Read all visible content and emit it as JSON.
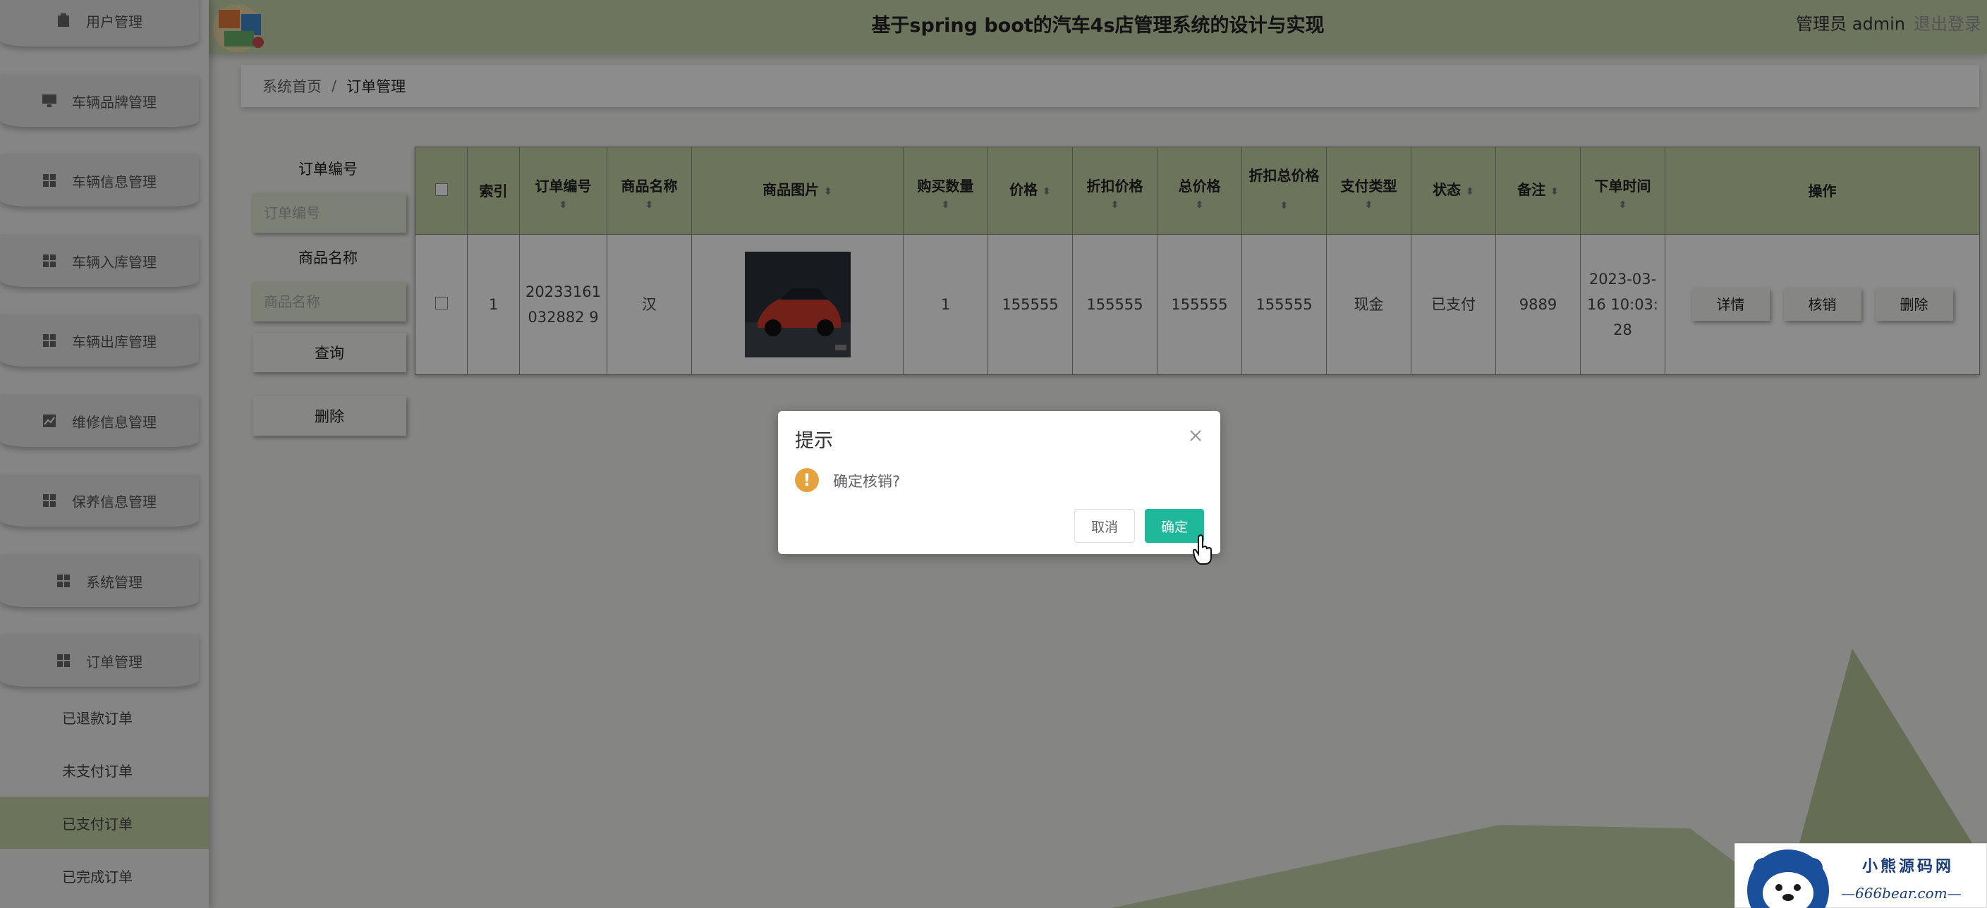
{
  "header": {
    "title": "基于spring boot的汽车4s店管理系统的设计与实现",
    "user_label": "管理员 admin",
    "logout_label": "退出登录"
  },
  "sidebar": {
    "items": [
      {
        "label": "用户管理",
        "icon": "clipboard-icon"
      },
      {
        "label": "车辆品牌管理",
        "icon": "monitor-icon"
      },
      {
        "label": "车辆信息管理",
        "icon": "grid-icon"
      },
      {
        "label": "车辆入库管理",
        "icon": "grid-icon"
      },
      {
        "label": "车辆出库管理",
        "icon": "grid-icon"
      },
      {
        "label": "维修信息管理",
        "icon": "chart-icon"
      },
      {
        "label": "保养信息管理",
        "icon": "grid-icon"
      },
      {
        "label": "系统管理",
        "icon": "grid-icon"
      },
      {
        "label": "订单管理",
        "icon": "grid-icon"
      }
    ],
    "sub_items": [
      {
        "label": "已退款订单",
        "active": false
      },
      {
        "label": "未支付订单",
        "active": false
      },
      {
        "label": "已支付订单",
        "active": true
      },
      {
        "label": "已完成订单",
        "active": false
      }
    ]
  },
  "breadcrumb": {
    "home": "系统首页",
    "separator": "/",
    "current": "订单管理"
  },
  "search": {
    "order_no_label": "订单编号",
    "order_no_placeholder": "订单编号",
    "product_name_label": "商品名称",
    "product_name_placeholder": "商品名称",
    "query_button": "查询",
    "delete_button": "删除"
  },
  "table": {
    "columns": [
      "索引",
      "订单编号",
      "商品名称",
      "商品图片",
      "购买数量",
      "价格",
      "折扣价格",
      "总价格",
      "折扣总价格",
      "支付类型",
      "状态",
      "备注",
      "下单时间",
      "操作"
    ],
    "rows": [
      {
        "index": "1",
        "order_no": "20233161032882 9",
        "product_name": "汉",
        "quantity": "1",
        "price": "155555",
        "discount_price": "155555",
        "total_price": "155555",
        "discount_total": "155555",
        "pay_type": "现金",
        "status": "已支付",
        "remark": "9889",
        "order_time": "2023-03-16 10:03:28"
      }
    ],
    "actions": {
      "detail": "详情",
      "verify": "核销",
      "delete": "删除"
    }
  },
  "dialog": {
    "title": "提示",
    "message": "确定核销?",
    "cancel": "取消",
    "confirm": "确定"
  },
  "watermark": {
    "cn": "小熊源码网",
    "url": "—666bear.com—"
  },
  "colors": {
    "header": "#c8d6ad",
    "active_sub": "#c5d4a8",
    "confirm": "#1fb89a",
    "warning": "#e6a23c"
  }
}
